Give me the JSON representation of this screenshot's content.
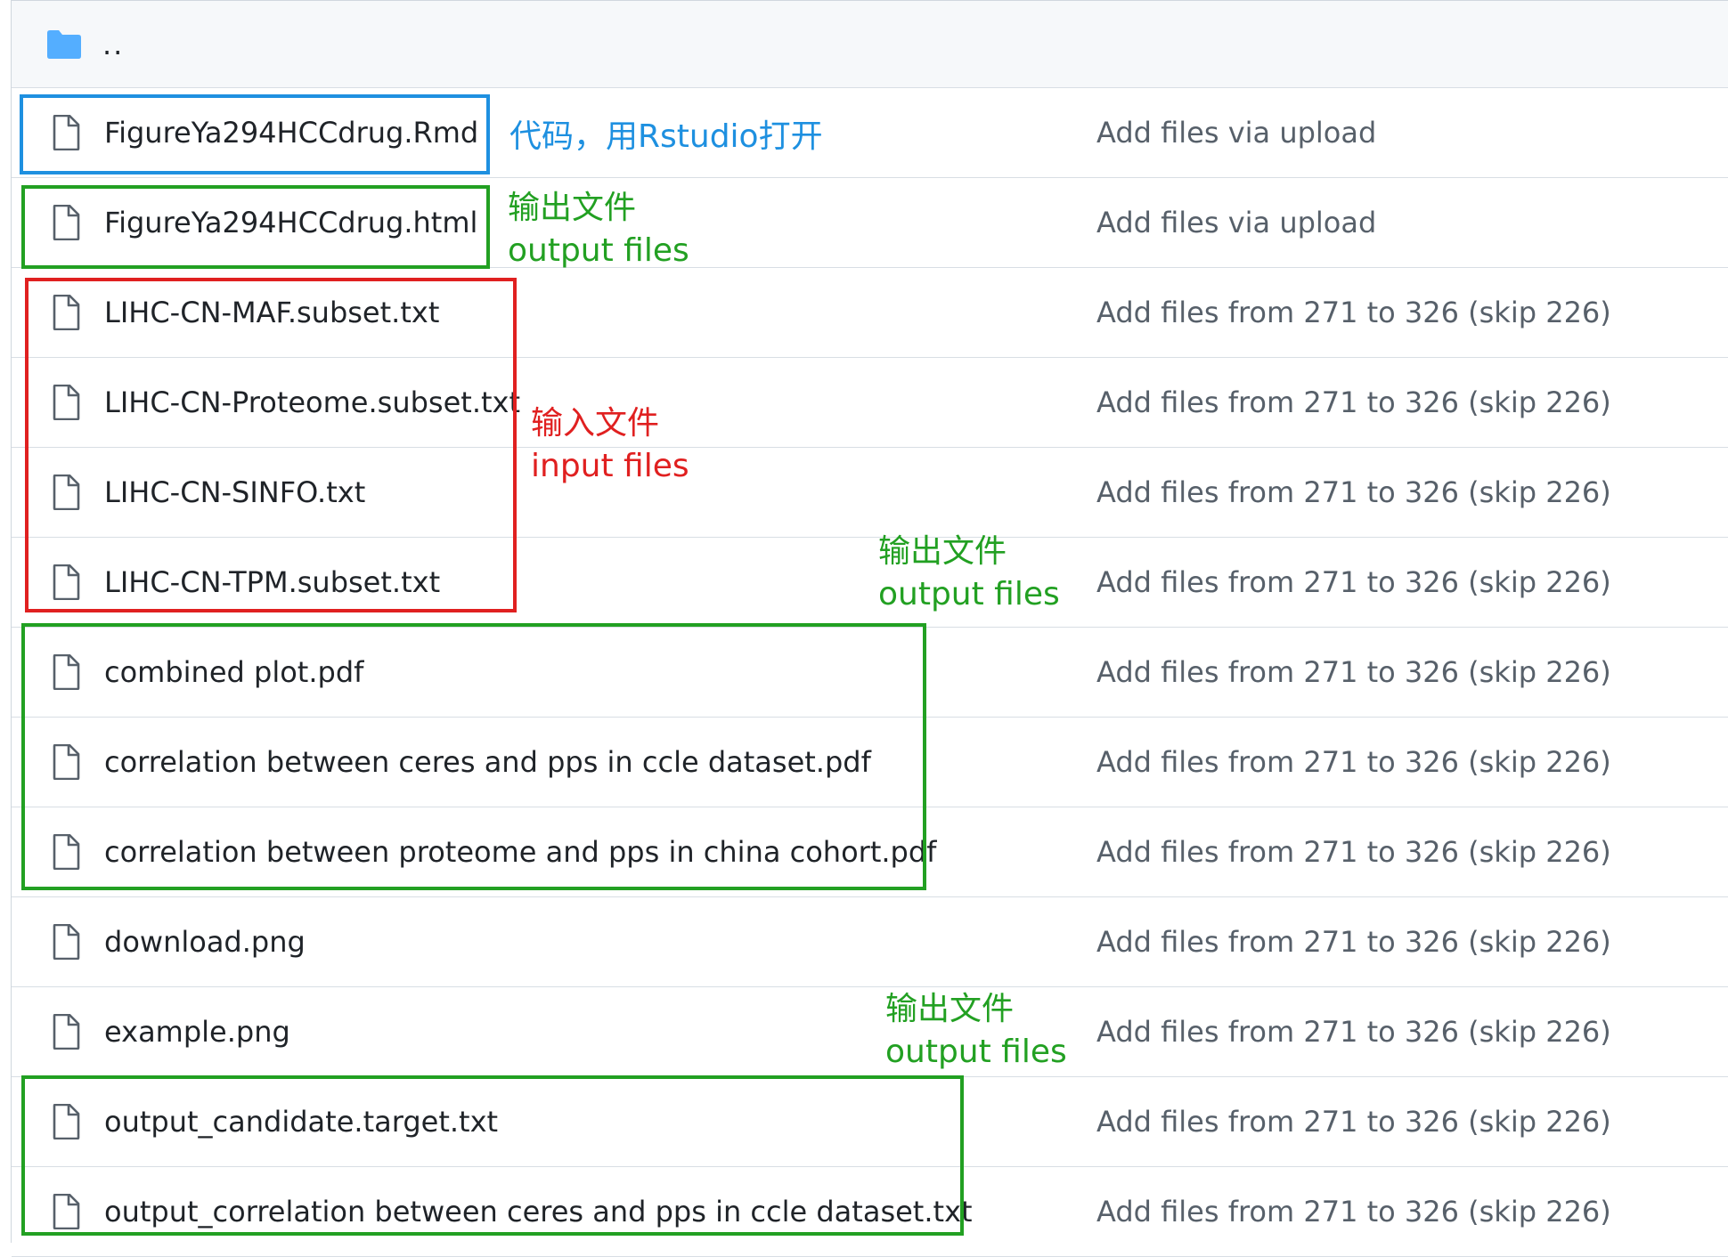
{
  "parent": {
    "label": "..",
    "icon": "folder-icon"
  },
  "rows": [
    {
      "name": "FigureYa294HCCdrug.Rmd",
      "commit": "Add files via upload",
      "icon": "file-icon"
    },
    {
      "name": "FigureYa294HCCdrug.html",
      "commit": "Add files via upload",
      "icon": "file-icon"
    },
    {
      "name": "LIHC-CN-MAF.subset.txt",
      "commit": "Add files from 271 to 326 (skip 226)",
      "icon": "file-icon"
    },
    {
      "name": "LIHC-CN-Proteome.subset.txt",
      "commit": "Add files from 271 to 326 (skip 226)",
      "icon": "file-icon"
    },
    {
      "name": "LIHC-CN-SINFO.txt",
      "commit": "Add files from 271 to 326 (skip 226)",
      "icon": "file-icon"
    },
    {
      "name": "LIHC-CN-TPM.subset.txt",
      "commit": "Add files from 271 to 326 (skip 226)",
      "icon": "file-icon"
    },
    {
      "name": "combined plot.pdf",
      "commit": "Add files from 271 to 326 (skip 226)",
      "icon": "file-icon"
    },
    {
      "name": "correlation between ceres and pps in ccle dataset.pdf",
      "commit": "Add files from 271 to 326 (skip 226)",
      "icon": "file-icon"
    },
    {
      "name": "correlation between proteome and pps in china cohort.pdf",
      "commit": "Add files from 271 to 326 (skip 226)",
      "icon": "file-icon"
    },
    {
      "name": "download.png",
      "commit": "Add files from 271 to 326 (skip 226)",
      "icon": "file-icon"
    },
    {
      "name": "example.png",
      "commit": "Add files from 271 to 326 (skip 226)",
      "icon": "file-icon"
    },
    {
      "name": "output_candidate.target.txt",
      "commit": "Add files from 271 to 326 (skip 226)",
      "icon": "file-icon"
    },
    {
      "name": "output_correlation between ceres and pps in ccle dataset.txt",
      "commit": "Add files from 271 to 326 (skip 226)",
      "icon": "file-icon"
    }
  ],
  "annotations": {
    "code": {
      "line1": "代码，用Rstudio打开",
      "color": "#1e90e0"
    },
    "output_html": {
      "line1": "输出文件",
      "line2": "output files",
      "color": "#22a022"
    },
    "input": {
      "line1": "输入文件",
      "line2": "input files",
      "color": "#e02020"
    },
    "output_pdf": {
      "line1": "输出文件",
      "line2": "output files",
      "color": "#22a022"
    },
    "output_txt": {
      "line1": "输出文件",
      "line2": "output files",
      "color": "#22a022"
    }
  }
}
